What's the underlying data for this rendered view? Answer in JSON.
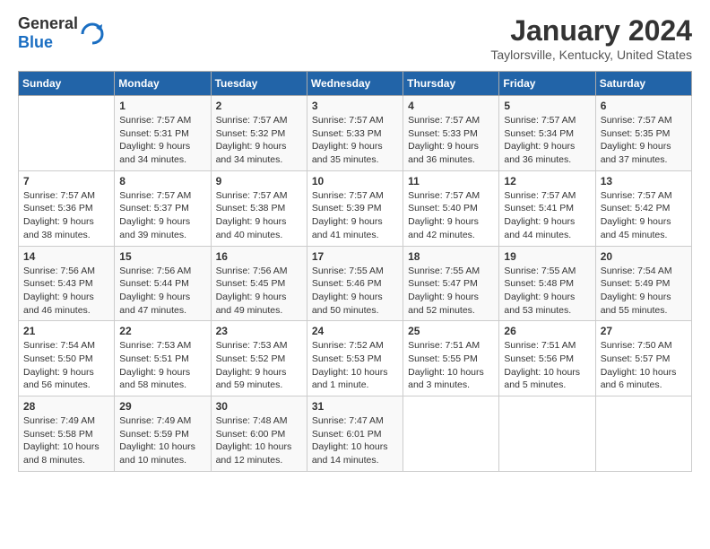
{
  "header": {
    "logo_general": "General",
    "logo_blue": "Blue",
    "title": "January 2024",
    "subtitle": "Taylorsville, Kentucky, United States"
  },
  "calendar": {
    "weekdays": [
      "Sunday",
      "Monday",
      "Tuesday",
      "Wednesday",
      "Thursday",
      "Friday",
      "Saturday"
    ],
    "weeks": [
      [
        {
          "day": "",
          "info": ""
        },
        {
          "day": "1",
          "info": "Sunrise: 7:57 AM\nSunset: 5:31 PM\nDaylight: 9 hours\nand 34 minutes."
        },
        {
          "day": "2",
          "info": "Sunrise: 7:57 AM\nSunset: 5:32 PM\nDaylight: 9 hours\nand 34 minutes."
        },
        {
          "day": "3",
          "info": "Sunrise: 7:57 AM\nSunset: 5:33 PM\nDaylight: 9 hours\nand 35 minutes."
        },
        {
          "day": "4",
          "info": "Sunrise: 7:57 AM\nSunset: 5:33 PM\nDaylight: 9 hours\nand 36 minutes."
        },
        {
          "day": "5",
          "info": "Sunrise: 7:57 AM\nSunset: 5:34 PM\nDaylight: 9 hours\nand 36 minutes."
        },
        {
          "day": "6",
          "info": "Sunrise: 7:57 AM\nSunset: 5:35 PM\nDaylight: 9 hours\nand 37 minutes."
        }
      ],
      [
        {
          "day": "7",
          "info": "Sunrise: 7:57 AM\nSunset: 5:36 PM\nDaylight: 9 hours\nand 38 minutes."
        },
        {
          "day": "8",
          "info": "Sunrise: 7:57 AM\nSunset: 5:37 PM\nDaylight: 9 hours\nand 39 minutes."
        },
        {
          "day": "9",
          "info": "Sunrise: 7:57 AM\nSunset: 5:38 PM\nDaylight: 9 hours\nand 40 minutes."
        },
        {
          "day": "10",
          "info": "Sunrise: 7:57 AM\nSunset: 5:39 PM\nDaylight: 9 hours\nand 41 minutes."
        },
        {
          "day": "11",
          "info": "Sunrise: 7:57 AM\nSunset: 5:40 PM\nDaylight: 9 hours\nand 42 minutes."
        },
        {
          "day": "12",
          "info": "Sunrise: 7:57 AM\nSunset: 5:41 PM\nDaylight: 9 hours\nand 44 minutes."
        },
        {
          "day": "13",
          "info": "Sunrise: 7:57 AM\nSunset: 5:42 PM\nDaylight: 9 hours\nand 45 minutes."
        }
      ],
      [
        {
          "day": "14",
          "info": "Sunrise: 7:56 AM\nSunset: 5:43 PM\nDaylight: 9 hours\nand 46 minutes."
        },
        {
          "day": "15",
          "info": "Sunrise: 7:56 AM\nSunset: 5:44 PM\nDaylight: 9 hours\nand 47 minutes."
        },
        {
          "day": "16",
          "info": "Sunrise: 7:56 AM\nSunset: 5:45 PM\nDaylight: 9 hours\nand 49 minutes."
        },
        {
          "day": "17",
          "info": "Sunrise: 7:55 AM\nSunset: 5:46 PM\nDaylight: 9 hours\nand 50 minutes."
        },
        {
          "day": "18",
          "info": "Sunrise: 7:55 AM\nSunset: 5:47 PM\nDaylight: 9 hours\nand 52 minutes."
        },
        {
          "day": "19",
          "info": "Sunrise: 7:55 AM\nSunset: 5:48 PM\nDaylight: 9 hours\nand 53 minutes."
        },
        {
          "day": "20",
          "info": "Sunrise: 7:54 AM\nSunset: 5:49 PM\nDaylight: 9 hours\nand 55 minutes."
        }
      ],
      [
        {
          "day": "21",
          "info": "Sunrise: 7:54 AM\nSunset: 5:50 PM\nDaylight: 9 hours\nand 56 minutes."
        },
        {
          "day": "22",
          "info": "Sunrise: 7:53 AM\nSunset: 5:51 PM\nDaylight: 9 hours\nand 58 minutes."
        },
        {
          "day": "23",
          "info": "Sunrise: 7:53 AM\nSunset: 5:52 PM\nDaylight: 9 hours\nand 59 minutes."
        },
        {
          "day": "24",
          "info": "Sunrise: 7:52 AM\nSunset: 5:53 PM\nDaylight: 10 hours\nand 1 minute."
        },
        {
          "day": "25",
          "info": "Sunrise: 7:51 AM\nSunset: 5:55 PM\nDaylight: 10 hours\nand 3 minutes."
        },
        {
          "day": "26",
          "info": "Sunrise: 7:51 AM\nSunset: 5:56 PM\nDaylight: 10 hours\nand 5 minutes."
        },
        {
          "day": "27",
          "info": "Sunrise: 7:50 AM\nSunset: 5:57 PM\nDaylight: 10 hours\nand 6 minutes."
        }
      ],
      [
        {
          "day": "28",
          "info": "Sunrise: 7:49 AM\nSunset: 5:58 PM\nDaylight: 10 hours\nand 8 minutes."
        },
        {
          "day": "29",
          "info": "Sunrise: 7:49 AM\nSunset: 5:59 PM\nDaylight: 10 hours\nand 10 minutes."
        },
        {
          "day": "30",
          "info": "Sunrise: 7:48 AM\nSunset: 6:00 PM\nDaylight: 10 hours\nand 12 minutes."
        },
        {
          "day": "31",
          "info": "Sunrise: 7:47 AM\nSunset: 6:01 PM\nDaylight: 10 hours\nand 14 minutes."
        },
        {
          "day": "",
          "info": ""
        },
        {
          "day": "",
          "info": ""
        },
        {
          "day": "",
          "info": ""
        }
      ]
    ]
  }
}
